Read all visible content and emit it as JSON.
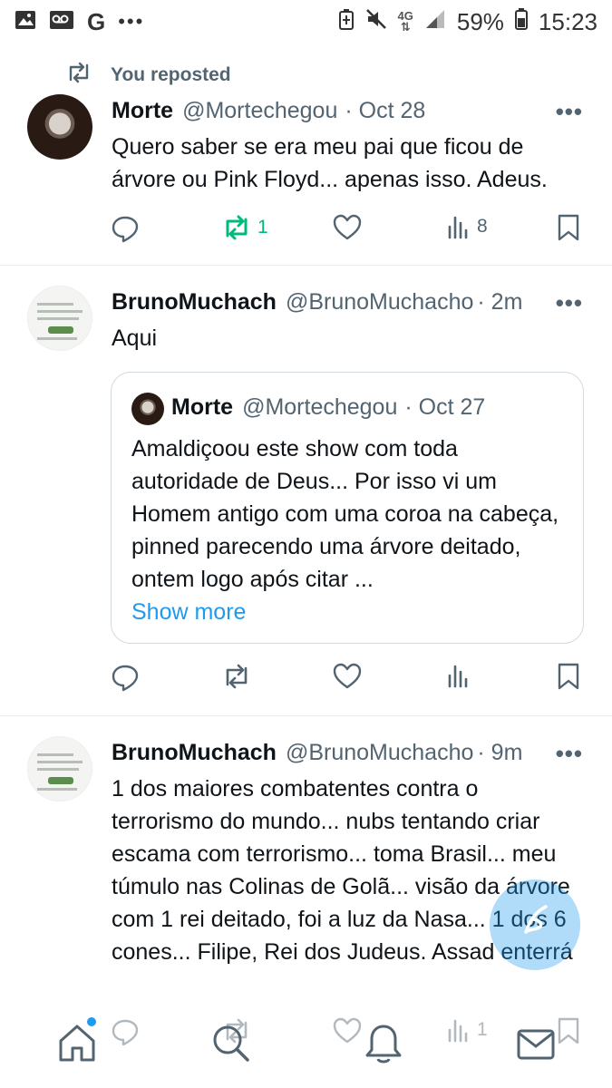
{
  "status_bar": {
    "left_icons": [
      "gallery-icon",
      "voicemail-icon",
      "google-g-icon",
      "more-notifications-icon"
    ],
    "g_label": "G",
    "dots": "•••",
    "network_label": "4G",
    "battery_percent": "59%",
    "time": "15:23"
  },
  "tweets": [
    {
      "repost_label": "You reposted",
      "name": "Morte",
      "handle": "@Mortechegou",
      "time": "· Oct 28",
      "text": "Quero saber se era meu pai que ficou de árvore ou Pink Floyd... apenas isso. Adeus.",
      "reply_count": "",
      "repost_count": "1",
      "like_count": "",
      "views_count": "8"
    },
    {
      "name": "BrunoMuchach",
      "handle": "@BrunoMuchacho",
      "time": "· 2m",
      "text": "Aqui",
      "quote": {
        "name": "Morte",
        "handle": "@Mortechegou",
        "time": "· Oct 27",
        "text": "Amaldiçoou este show com toda autoridade de Deus... Por isso vi um Homem antigo com uma coroa na cabeça, pinned parecendo uma árvore deitado, ontem logo após citar ...",
        "show_more": "Show more"
      },
      "views_count": ""
    },
    {
      "name": "BrunoMuchach",
      "handle": "@BrunoMuchacho",
      "time": "· 9m",
      "text": "1 dos maiores combatentes contra o terrorismo do mundo... nubs tentando criar escama com terrorismo... toma Brasil... meu túmulo nas Colinas de Golã... visão da árvore com 1 rei deitado, foi a luz da Nasa... 1 dos 6 cones... Filipe, Rei dos Judeus. Assad enterrá",
      "views_count": "1"
    }
  ],
  "more_glyph": "•••",
  "bottom_nav": [
    "home-icon",
    "search-icon",
    "notifications-icon",
    "messages-icon"
  ],
  "colors": {
    "accent": "#1d9bf0",
    "repost_green": "#00ba7c",
    "muted": "#536471"
  }
}
